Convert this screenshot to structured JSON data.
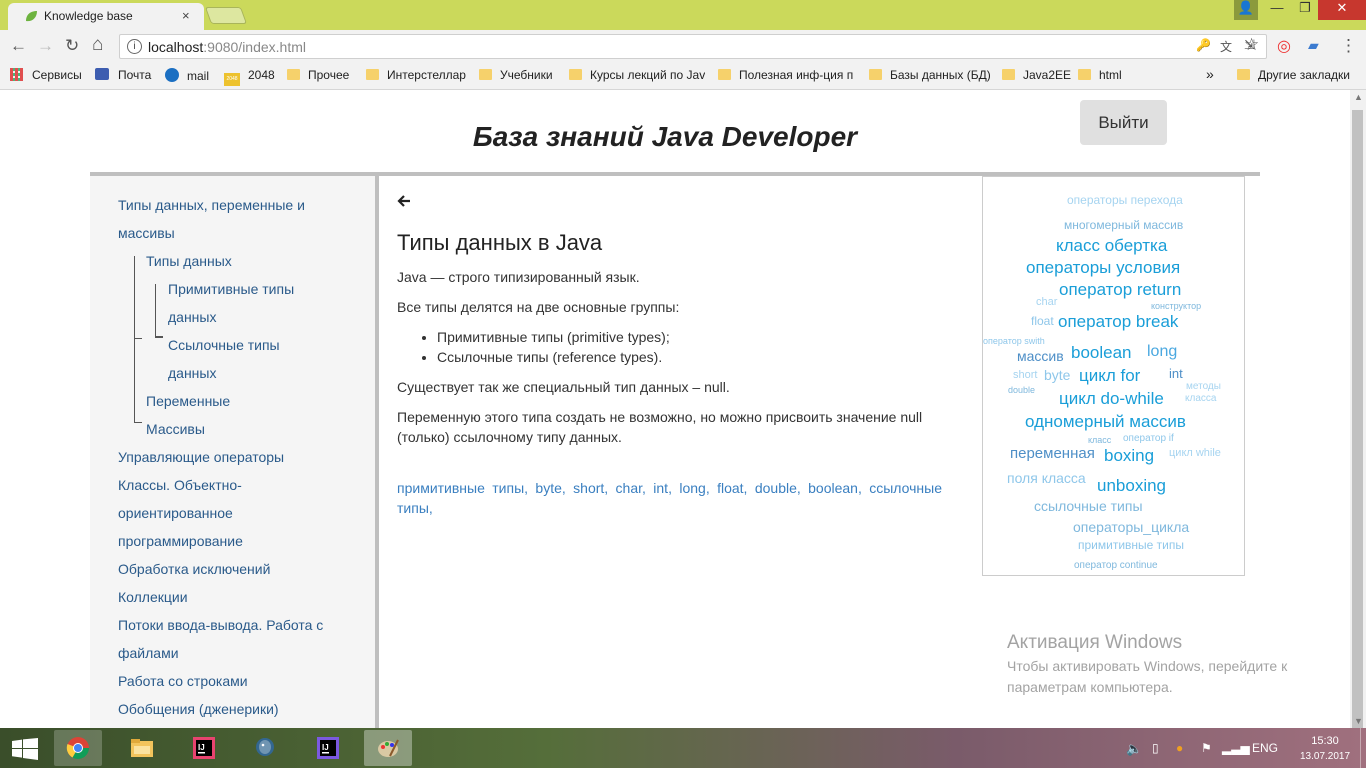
{
  "browser": {
    "tab_title": "Knowledge base",
    "tab_close": "×",
    "url_host": "localhost",
    "url_rest": ":9080/index.html",
    "info_glyph": "i",
    "window_controls": {
      "user": "👤",
      "minimize": "—",
      "maximize": "❐",
      "close": "✕"
    },
    "nav_glyphs": {
      "back": "←",
      "forward": "→",
      "reload": "↻",
      "home": "⌂"
    },
    "omni_icons": {
      "key": "🔑",
      "translate": "文",
      "cast": "⇲",
      "star": "☆"
    },
    "ext_icons": {
      "ext1": "◎",
      "ext2": "▰",
      "menu": "⋮"
    },
    "bookmarks": [
      {
        "label": "Сервисы",
        "icon": "apps-icon"
      },
      {
        "label": "Почта",
        "icon": "mail-icon"
      },
      {
        "label": "mail",
        "icon": "at-icon"
      },
      {
        "label": "2048",
        "icon": "2048-icon"
      },
      {
        "label": "Прочее",
        "icon": "folder-icon"
      },
      {
        "label": "Интерстеллар",
        "icon": "folder-icon"
      },
      {
        "label": "Учебники",
        "icon": "folder-icon"
      },
      {
        "label": "Курсы лекций по Jav",
        "icon": "folder-icon"
      },
      {
        "label": "Полезная инф-ция п",
        "icon": "folder-icon"
      },
      {
        "label": "Базы данных (БД)",
        "icon": "folder-icon"
      },
      {
        "label": "Java2EE",
        "icon": "folder-icon"
      },
      {
        "label": "html",
        "icon": "folder-icon"
      }
    ],
    "bookmarks_more": "»",
    "other_bookmarks": "Другие закладки",
    "icon_2048_text": "2048"
  },
  "page": {
    "title": "База знаний Java Developer",
    "logout": "Выйти",
    "sidebar": [
      "Типы данных, переменные и",
      "массивы",
      "Типы данных",
      "Примитивные типы",
      "данных",
      "Ссылочные типы",
      "данных",
      "Переменные",
      "Массивы",
      "Управляющие операторы",
      "Классы. Объектно-",
      "ориентированное",
      "программирование",
      "Обработка исключений",
      "Коллекции",
      "Потоки ввода-вывода. Работа с",
      "файлами",
      "Работа со строками",
      "Обобщения (дженерики)"
    ],
    "back_glyph": "🡐",
    "article": {
      "heading": "Типы данных в Java",
      "p1": "Java — строго типизированный язык.",
      "p2": "Все типы делятся на две основные группы:",
      "list": [
        "Примитивные типы (primitive types);",
        "Ссылочные типы (reference types)."
      ],
      "p3": "Существует так же специальный тип данных – null.",
      "p4": "Переменную этого типа создать не возможно, но можно присвоить значение null (только) ссылочному типу данных."
    },
    "tags": "примитивные типы,  byte,  short,  char,  int,  long,  float,  double,  boolean,  ссылочные типы,",
    "cloud": [
      "операторы перехода",
      "многомерный массив",
      "класс обертка",
      "операторы условия",
      "оператор return",
      "char",
      "конструктор",
      "float",
      "оператор break",
      "оператор swith",
      "массив",
      "boolean",
      "long",
      "short",
      "byte",
      "цикл for",
      "int",
      "методы",
      "класса",
      "double",
      "цикл do-while",
      "одномерный массив",
      "класс",
      "оператор if",
      "переменная",
      "boxing",
      "цикл while",
      "поля класса",
      "unboxing",
      "ссылочные типы",
      "операторы_цикла",
      "примитивные типы",
      "оператор continue"
    ]
  },
  "windows": {
    "watermark_title": "Активация Windows",
    "watermark_line1": "Чтобы активировать Windows, перейдите к",
    "watermark_line2": "параметрам компьютера.",
    "lang": "ENG",
    "time": "15:30",
    "date": "13.07.2017"
  },
  "colors": {
    "titlebar": "#cbd95b",
    "link": "#2a5a8a",
    "cloud_dark": "#1a9ed8",
    "cloud_light": "#8fc7ea"
  }
}
